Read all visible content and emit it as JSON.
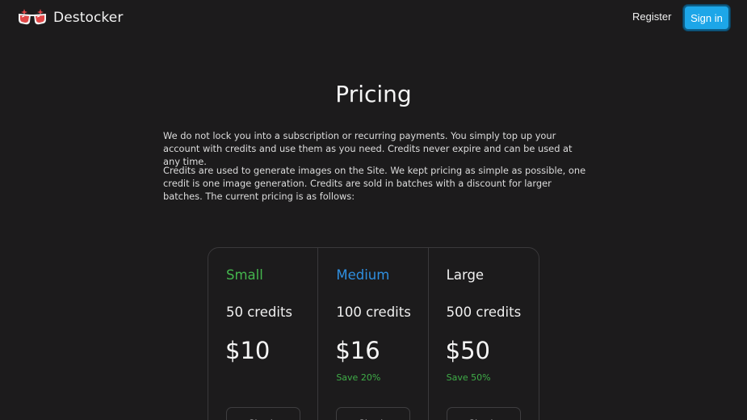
{
  "header": {
    "brand_name": "Destocker",
    "register_label": "Register",
    "signin_label": "Sign in"
  },
  "colors": {
    "background": "#1c1b1c",
    "accent": "#1da6e8",
    "small_plan": "#44b54d",
    "medium_plan": "#2f8fe0",
    "save_text": "#3fae48"
  },
  "main": {
    "title": "Pricing",
    "paragraph1": "We do not lock you into a subscription or recurring payments. You simply top up your account with credits and use them as you need. Credits never expire and can be used at any time.",
    "paragraph2": "Credits are used to generate images on the Site. We kept pricing as simple as possible, one credit is one image generation. Credits are sold in batches with a discount for larger batches. The current pricing is as follows:"
  },
  "plans": [
    {
      "name": "Small",
      "credits": "50 credits",
      "price": "$10",
      "save": "",
      "button_label": "Sign in"
    },
    {
      "name": "Medium",
      "credits": "100 credits",
      "price": "$16",
      "save": "Save 20%",
      "button_label": "Sign in"
    },
    {
      "name": "Large",
      "credits": "500 credits",
      "price": "$50",
      "save": "Save 50%",
      "button_label": "Sign in"
    }
  ]
}
